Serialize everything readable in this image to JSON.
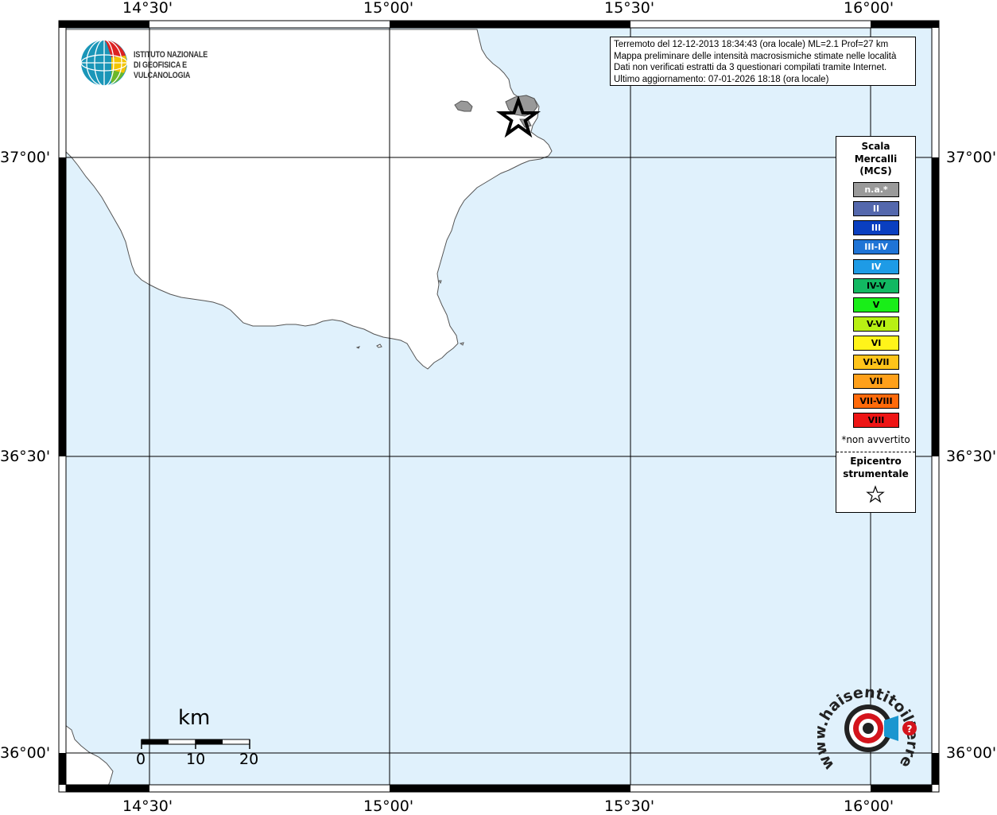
{
  "map": {
    "lon_labels": [
      "14°30'",
      "15°00'",
      "15°30'",
      "16°00'"
    ],
    "lat_labels": [
      "37°00'",
      "36°30'",
      "36°00'"
    ],
    "colors": {
      "sea": "#e0f1fc",
      "land": "#ffffff",
      "coast": "#555555",
      "island": "#999999",
      "frame": "#000000"
    }
  },
  "info_box": {
    "line1": "Terremoto del 12-12-2013 18:34:43 (ora locale) ML=2.1 Prof=27 km",
    "line2": "Mappa preliminare delle intensità macrosismiche stimate nelle località",
    "line3": "Dati non verificati estratti da 3 questionari compilati tramite Internet.",
    "line4": "Ultimo aggiornamento: 07-01-2026 18:18 (ora locale)"
  },
  "logo": {
    "line1": "ISTITUTO NAZIONALE",
    "line2": "DI GEOFISICA E VULCANOLOGIA",
    "icon": "ingv-globe-icon"
  },
  "legend": {
    "title1": "Scala",
    "title2": "Mercalli",
    "title3": "(MCS)",
    "levels": [
      {
        "label": "n.a.*",
        "color": "#9a9a9a",
        "text_color": "#ffffff"
      },
      {
        "label": "II",
        "color": "#5468ad",
        "text_color": "#ffffff"
      },
      {
        "label": "III",
        "color": "#0a3fc0",
        "text_color": "#ffffff"
      },
      {
        "label": "III-IV",
        "color": "#1f74d6",
        "text_color": "#ffffff"
      },
      {
        "label": "IV",
        "color": "#1e9be6",
        "text_color": "#ffffff"
      },
      {
        "label": "IV-V",
        "color": "#12b862",
        "text_color": "#000000"
      },
      {
        "label": "V",
        "color": "#19ee18",
        "text_color": "#000000"
      },
      {
        "label": "V-VI",
        "color": "#b8f014",
        "text_color": "#000000"
      },
      {
        "label": "VI",
        "color": "#fff41a",
        "text_color": "#000000"
      },
      {
        "label": "VI-VII",
        "color": "#ffc41a",
        "text_color": "#000000"
      },
      {
        "label": "VII",
        "color": "#ffa01a",
        "text_color": "#000000"
      },
      {
        "label": "VII-VIII",
        "color": "#ff6a0a",
        "text_color": "#000000"
      },
      {
        "label": "VIII",
        "color": "#ee1515",
        "text_color": "#000000"
      }
    ],
    "na_note": "*non avvertito",
    "epicenter1": "Epicentro",
    "epicenter2": "strumentale",
    "epicenter_icon": "star-icon"
  },
  "scale_bar": {
    "unit": "km",
    "ticks": [
      "0",
      "10",
      "20"
    ]
  },
  "badge": {
    "text": "www.haisentitoilterremoto.it",
    "icon": "haisentito-logo-icon",
    "color": "#d4141c"
  }
}
